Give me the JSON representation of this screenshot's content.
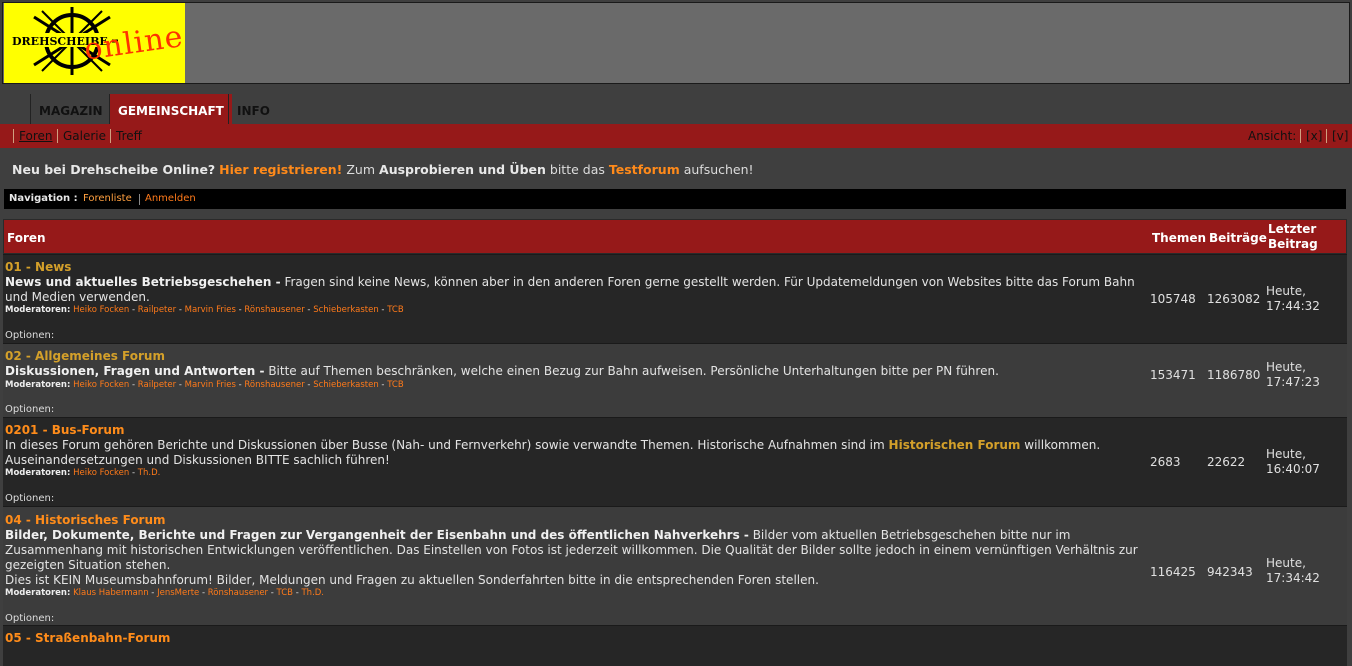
{
  "logo": {
    "word1": "Drehscheibe",
    "word2": "online"
  },
  "main_nav": [
    "MAGAZIN",
    "GEMEINSCHAFT",
    "INFO"
  ],
  "sub_nav": {
    "items": [
      "Foren",
      "Galerie",
      "Treff"
    ],
    "view_label": "Ansicht:",
    "view_x": "[x]",
    "view_v": "[v]"
  },
  "notice": {
    "p1": "Neu bei Drehscheibe Online?",
    "link1": "Hier registrieren!",
    "p2": "Zum",
    "b1": "Ausprobieren und Üben",
    "p3": "bitte das",
    "link2": "Testforum",
    "p4": "aufsuchen!"
  },
  "navbar": {
    "label": "Navigation :",
    "link1": "Forenliste",
    "link2": "Anmelden"
  },
  "table": {
    "col_forum": "Foren",
    "col_topics": "Themen",
    "col_posts": "Beiträge",
    "col_last1": "Letzter",
    "col_last2": "Beitrag"
  },
  "forums": [
    {
      "title": "01 - News",
      "bold": "News und aktuelles Betriebsgeschehen -",
      "desc": "Fragen sind keine News, können aber in den anderen Foren gerne gestellt werden. Für Updatemeldungen von Websites bitte das Forum Bahn und Medien verwenden.",
      "mods_label": "Moderatoren:",
      "mods": [
        "Heiko Focken",
        "Railpeter",
        "Marvin Fries",
        "Rönshausener",
        "Schieberkasten",
        "TCB"
      ],
      "options": "Optionen:",
      "topics": "105748",
      "posts": "1263082",
      "last1": "Heute,",
      "last2": "17:44:32"
    },
    {
      "title": "02 - Allgemeines Forum",
      "bold": "Diskussionen, Fragen und Antworten -",
      "desc": "Bitte auf Themen beschränken, welche einen Bezug zur Bahn aufweisen. Persönliche Unterhaltungen bitte per PN führen.",
      "mods_label": "Moderatoren:",
      "mods": [
        "Heiko Focken",
        "Railpeter",
        "Marvin Fries",
        "Rönshausener",
        "Schieberkasten",
        "TCB"
      ],
      "options": "Optionen:",
      "topics": "153471",
      "posts": "1186780",
      "last1": "Heute,",
      "last2": "17:47:23"
    },
    {
      "title": "0201 - Bus-Forum",
      "desc_a": "In dieses Forum gehören Berichte und Diskussionen über Busse (Nah- und Fernverkehr) sowie verwandte Themen. Historische Aufnahmen sind im",
      "desc_link": "Historischen Forum",
      "desc_b": "willkommen.",
      "desc_c": "Auseinandersetzungen und Diskussionen BITTE sachlich führen!",
      "mods_label": "Moderatoren:",
      "mods": [
        "Heiko Focken",
        "Th.D."
      ],
      "options": "Optionen:",
      "topics": "2683",
      "posts": "22622",
      "last1": "Heute,",
      "last2": "16:40:07"
    },
    {
      "title": "04 - Historisches Forum",
      "bold": "Bilder, Dokumente, Berichte und Fragen zur Vergangenheit der Eisenbahn und des öffentlichen Nahverkehrs -",
      "desc": "Bilder vom aktuellen Betriebsgeschehen bitte nur im Zusammenhang mit historischen Entwicklungen veröffentlichen. Das Einstellen von Fotos ist jederzeit willkommen. Die Qualität der Bilder sollte jedoch in einem vernünftigen Verhältnis zur gezeigten Situation stehen.",
      "desc2": "Dies ist KEIN Museumsbahnforum! Bilder, Meldungen und Fragen zu aktuellen Sonderfahrten bitte in die entsprechenden Foren stellen.",
      "mods_label": "Moderatoren:",
      "mods": [
        "Klaus Habermann",
        "JensMerte",
        "Rönshausener",
        "TCB",
        "Th.D."
      ],
      "options": "Optionen:",
      "topics": "116425",
      "posts": "942343",
      "last1": "Heute,",
      "last2": "17:34:42"
    },
    {
      "title": "05 - Straßenbahn-Forum"
    }
  ]
}
